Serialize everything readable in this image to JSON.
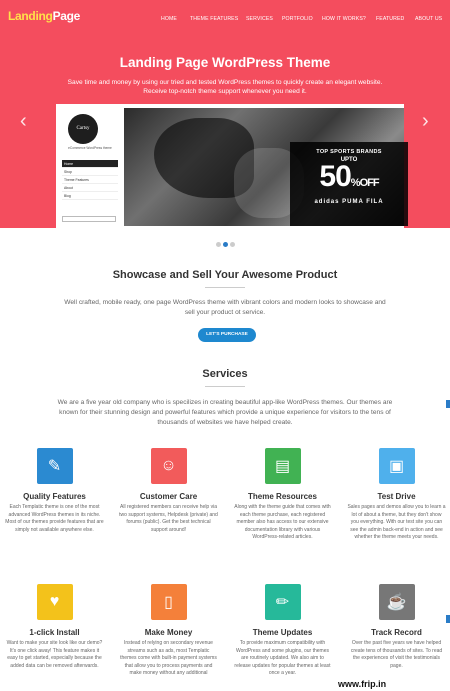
{
  "logo": {
    "part1": "Landing",
    "part2": "Page"
  },
  "nav": [
    "HOME",
    "THEME FEATURES",
    "SERVICES",
    "PORTFOLIO",
    "HOW IT WORKS?",
    "FEATURED",
    "ABOUT US"
  ],
  "hero": {
    "title": "Landing Page WordPress Theme",
    "subtitle": "Save time and money by using our tried and tested WordPress themes to quickly create an elegant website. Receive top-notch theme support whenever you need it.",
    "prev_icon": "chevron-left-icon",
    "next_icon": "chevron-right-icon"
  },
  "slide": {
    "logo_text": "Cartsy",
    "tagline": "eCommerce WordPress theme",
    "menu": [
      "Home",
      "Shop",
      "Theme Features",
      "About",
      "Blog"
    ],
    "promo_line1": "TOP SPORTS BRANDS",
    "promo_line2": "UPTO",
    "promo_value": "50",
    "promo_unit": "%",
    "promo_off": "OFF",
    "brands": "adidas PUMA FILA"
  },
  "showcase": {
    "title": "Showcase and Sell Your Awesome Product",
    "text": "Well crafted, mobile ready, one page WordPress theme with vibrant colors and modern looks to showcase and sell your product ot service.",
    "button": "LET'S PURCHASE"
  },
  "services": {
    "title": "Services",
    "text": "We are a five year old company who is specilizes in creating beautiful app-like WordPress themes. Our themes are known for their stunning design and powerful features which provide a unique experience for visitors to the tens of thousands of websites we have helped create."
  },
  "features": [
    {
      "title": "Quality Features",
      "icon": "edit-icon",
      "color": "#2b8ad1",
      "desc": "Each Templatic theme is one of the most advanced WordPress themes in its niche. Most of our themes provide features that are simply not available anywhere else."
    },
    {
      "title": "Customer Care",
      "icon": "user-icon",
      "color": "#f25b5b",
      "desc": "All registered members can receive help via two support systems, Helpdesk (private) and forums (public). Get the best technical support around!"
    },
    {
      "title": "Theme Resources",
      "icon": "book-icon",
      "color": "#41b253",
      "desc": "Along with the theme guide that comes with each theme purchase, each registered member also has access to our extensive documentation library with various WordPress-related articles."
    },
    {
      "title": "Test Drive",
      "icon": "truck-icon",
      "color": "#4fb0ec",
      "desc": "Sales pages and demos allow you to learn a lot of about a theme, but they don't show you everything. With our test site you can see the admin back-end in action and see whether the theme meets your needs."
    },
    {
      "title": "1-click Install",
      "icon": "heart-icon",
      "color": "#f3c21b",
      "desc": "Want to make your site look like our demo? It's one click away! This feature makes it easy to get started, especially because the added data can be removed afterwards."
    },
    {
      "title": "Make Money",
      "icon": "mobile-icon",
      "color": "#f4803a",
      "desc": "Instead of relying on secondary revenue streams such as ads, most Templatic themes come with built-in payment systems that allow you to process payments and make money without any additional"
    },
    {
      "title": "Theme Updates",
      "icon": "pencil-icon",
      "color": "#26b99a",
      "desc": "To provide maximum compatibility with WordPress and some plugins, our themes are routinely updated. We also aim to release updates for popular themes at least once a year."
    },
    {
      "title": "Track Record",
      "icon": "coffee-icon",
      "color": "#777777",
      "desc": "Over the past five years we have helped create tens of thousands of sites. To read the experiences of visit the testimonials page."
    }
  ],
  "watermark": "www.frip.in"
}
